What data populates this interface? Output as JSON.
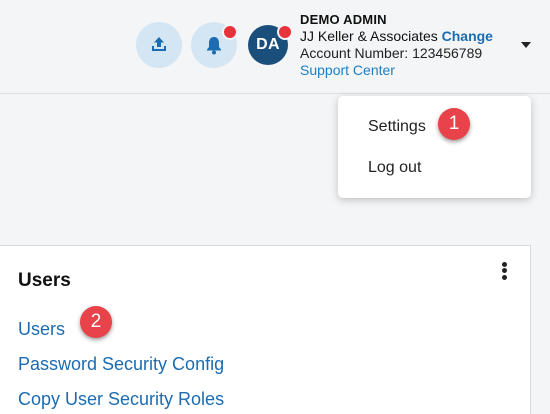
{
  "header": {
    "upload_icon": "upload-icon",
    "bell_icon": "bell-icon",
    "avatar_initials": "DA",
    "account": {
      "name": "DEMO ADMIN",
      "company": "JJ Keller & Associates",
      "change_label": "Change",
      "account_number_label": "Account Number:",
      "account_number": "123456789",
      "support_label": "Support Center"
    }
  },
  "dropdown": {
    "items": [
      {
        "label": "Settings"
      },
      {
        "label": "Log out"
      }
    ]
  },
  "markers": [
    "1",
    "2"
  ],
  "panel": {
    "title": "Users",
    "links": [
      {
        "label": "Users"
      },
      {
        "label": "Password Security Config"
      },
      {
        "label": "Copy User Security Roles"
      }
    ]
  },
  "colors": {
    "accent": "#1b6cb2",
    "avatar": "#1a4f7c",
    "notification": "#e8323c",
    "icon_bg": "#d4e6f3"
  }
}
